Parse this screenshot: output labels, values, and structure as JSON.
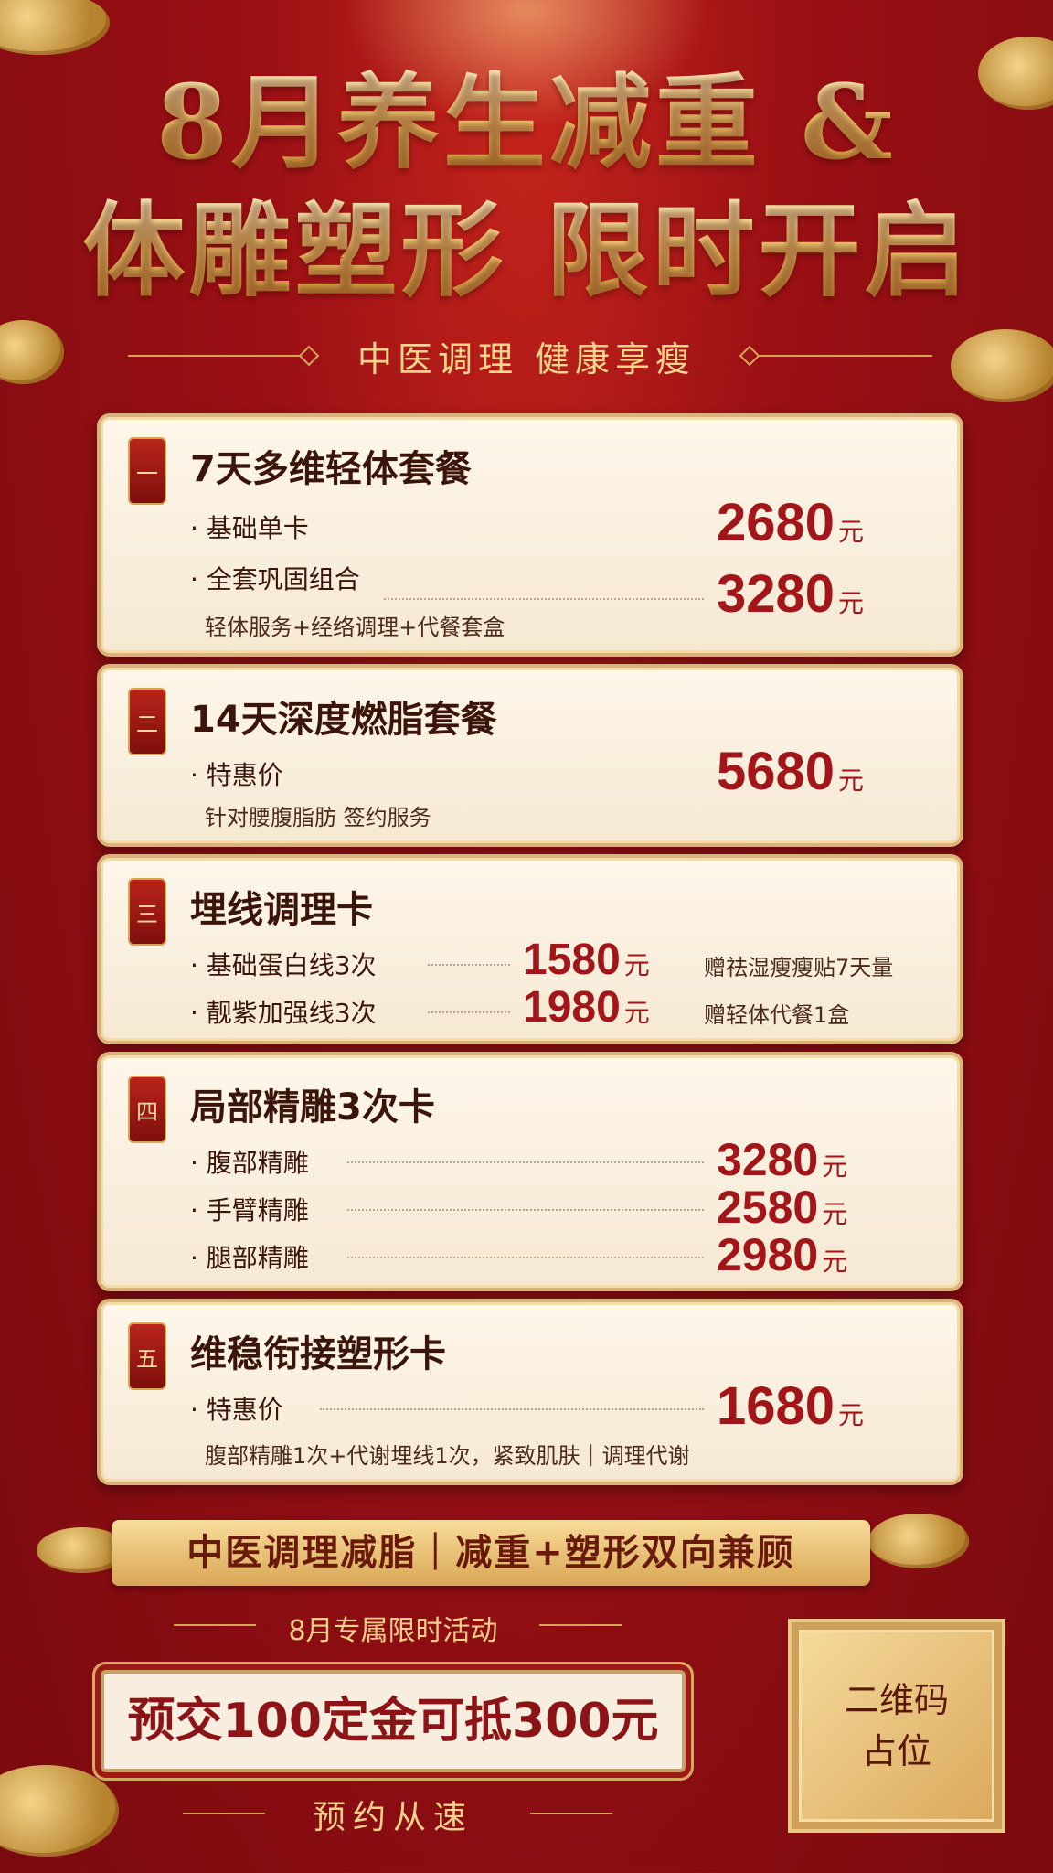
{
  "header": {
    "title_line1": "8月养生减重 &",
    "title_line2": "体雕塑形 限时开启",
    "subtitle": "中医调理 健康享瘦"
  },
  "packages": [
    {
      "badge": "一",
      "title": "7天多维轻体套餐",
      "rows": [
        {
          "label": "· 基础单卡",
          "price": "2680",
          "unit": "元"
        },
        {
          "label": "· 全套巩固组合",
          "price": "3280",
          "unit": "元"
        }
      ],
      "note": "轻体服务+经络调理+代餐套盒"
    },
    {
      "badge": "二",
      "title": "14天深度燃脂套餐",
      "rows": [
        {
          "label": "· 特惠价",
          "price": "5680",
          "unit": "元"
        }
      ],
      "note": "针对腰腹脂肪 签约服务"
    },
    {
      "badge": "三",
      "title": "埋线调理卡",
      "rows": [
        {
          "label": "· 基础蛋白线3次",
          "price": "1580",
          "unit": "元",
          "gift": "赠祛湿瘦瘦贴7天量"
        },
        {
          "label": "· 靓紫加强线3次",
          "price": "1980",
          "unit": "元",
          "gift": "赠轻体代餐1盒"
        }
      ]
    },
    {
      "badge": "四",
      "title": "局部精雕3次卡",
      "rows": [
        {
          "label": "· 腹部精雕",
          "price": "3280",
          "unit": "元"
        },
        {
          "label": "· 手臂精雕",
          "price": "2580",
          "unit": "元"
        },
        {
          "label": "· 腿部精雕",
          "price": "2980",
          "unit": "元"
        }
      ]
    },
    {
      "badge": "五",
      "title": "维稳衔接塑形卡",
      "rows": [
        {
          "label": "· 特惠价",
          "price": "1680",
          "unit": "元"
        }
      ],
      "note": "腹部精雕1次+代谢埋线1次，紧致肌肤｜调理代谢"
    }
  ],
  "footer": {
    "banner": "中医调理减脂｜减重+塑形双向兼顾",
    "activity": "8月专属限时活动",
    "deposit": "预交100定金可抵300元",
    "booking": "预约从速",
    "qr_line1": "二维码",
    "qr_line2": "占位"
  },
  "colors": {
    "background": "#9b1014",
    "gold": "#f0c46a",
    "card": "#fdf6ea",
    "price": "#a2161a"
  },
  "icons": [
    "cloud-ornament",
    "diamond-ornament"
  ]
}
